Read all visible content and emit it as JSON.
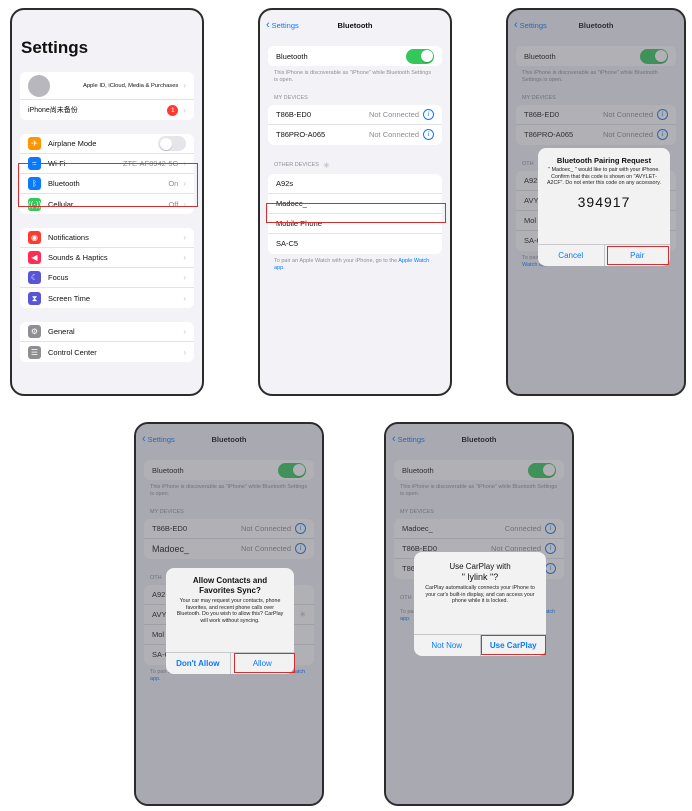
{
  "screen1": {
    "title": "Settings",
    "profile_label": "Apple ID, iCloud, Media & Purchases",
    "backup_label": "iPhone尚未备份",
    "backup_badge": "1",
    "rows_a": [
      {
        "label": "Airplane Mode"
      },
      {
        "label": "Wi-Fi",
        "value": "ZTE-AF8942-5G"
      },
      {
        "label": "Bluetooth",
        "value": "On"
      },
      {
        "label": "Cellular",
        "value": "Off"
      }
    ],
    "rows_b": [
      {
        "label": "Notifications"
      },
      {
        "label": "Sounds & Haptics"
      },
      {
        "label": "Focus"
      },
      {
        "label": "Screen Time"
      }
    ],
    "rows_c": [
      {
        "label": "General"
      },
      {
        "label": "Control Center"
      }
    ],
    "icon_colors": {
      "airplane": "#ff9500",
      "wifi": "#0a7aff",
      "bluetooth": "#0a7aff",
      "cellular": "#34c759",
      "notifications": "#ff3b30",
      "sounds": "#ff2d55",
      "focus": "#5856d6",
      "screentime": "#5856d6",
      "general": "#8e8e93",
      "control": "#8e8e93"
    }
  },
  "bt": {
    "back": "Settings",
    "title": "Bluetooth",
    "toggle_label": "Bluetooth",
    "discoverable": "This iPhone is discoverable as \"iPhone\" while Bluetooth Settings is open.",
    "my_devices": "MY DEVICES",
    "other_devices": "OTHER DEVICES",
    "not_connected": "Not Connected",
    "connected": "Connected",
    "pair_note": "To pair an Apple Watch with your iPhone, go to the",
    "watch_link": "Apple Watch app."
  },
  "screen2": {
    "my_devices": [
      "T86B-ED0",
      "T86PRO-A065"
    ],
    "other_devices": [
      "A92s",
      "Madoec_",
      "Mobile Phone",
      "SA-C5"
    ]
  },
  "screen3": {
    "my_devices": [
      "T86B-ED0",
      "T86PRO-A065"
    ],
    "partial": [
      "A92",
      "AVY",
      "Mol",
      "SA-C5"
    ],
    "alert": {
      "title": "Bluetooth Pairing Request",
      "message": "\" Madoec_ \" would like to pair with your iPhone. Confirm that this code is shown on \"AVYLET-A2CF\". Do not enter this code on any accessory.",
      "code": "394917",
      "cancel": "Cancel",
      "pair": "Pair"
    }
  },
  "screen4": {
    "my_devices": [
      "T86B-ED0",
      "Madoec_"
    ],
    "partial": [
      "A92",
      "AVY",
      "Mol",
      "SA-C5"
    ],
    "alert": {
      "title": "Allow Contacts and Favorites Sync?",
      "message": "Your car may request your contacts, phone favorites, and recent phone calls over Bluetooth. Do you wish to allow this? CarPlay will work without syncing.",
      "deny": "Don't Allow",
      "allow": "Allow"
    }
  },
  "screen5": {
    "my_devices": [
      "Madoec_",
      "T86B-ED0",
      "T86"
    ],
    "alert": {
      "title": "Use CarPlay with",
      "device": "\"  lylink  \"?",
      "message": "CarPlay automatically connects your iPhone to your car's built-in display, and can access your phone while it is locked.",
      "not_now": "Not Now",
      "use": "Use CarPlay"
    }
  }
}
